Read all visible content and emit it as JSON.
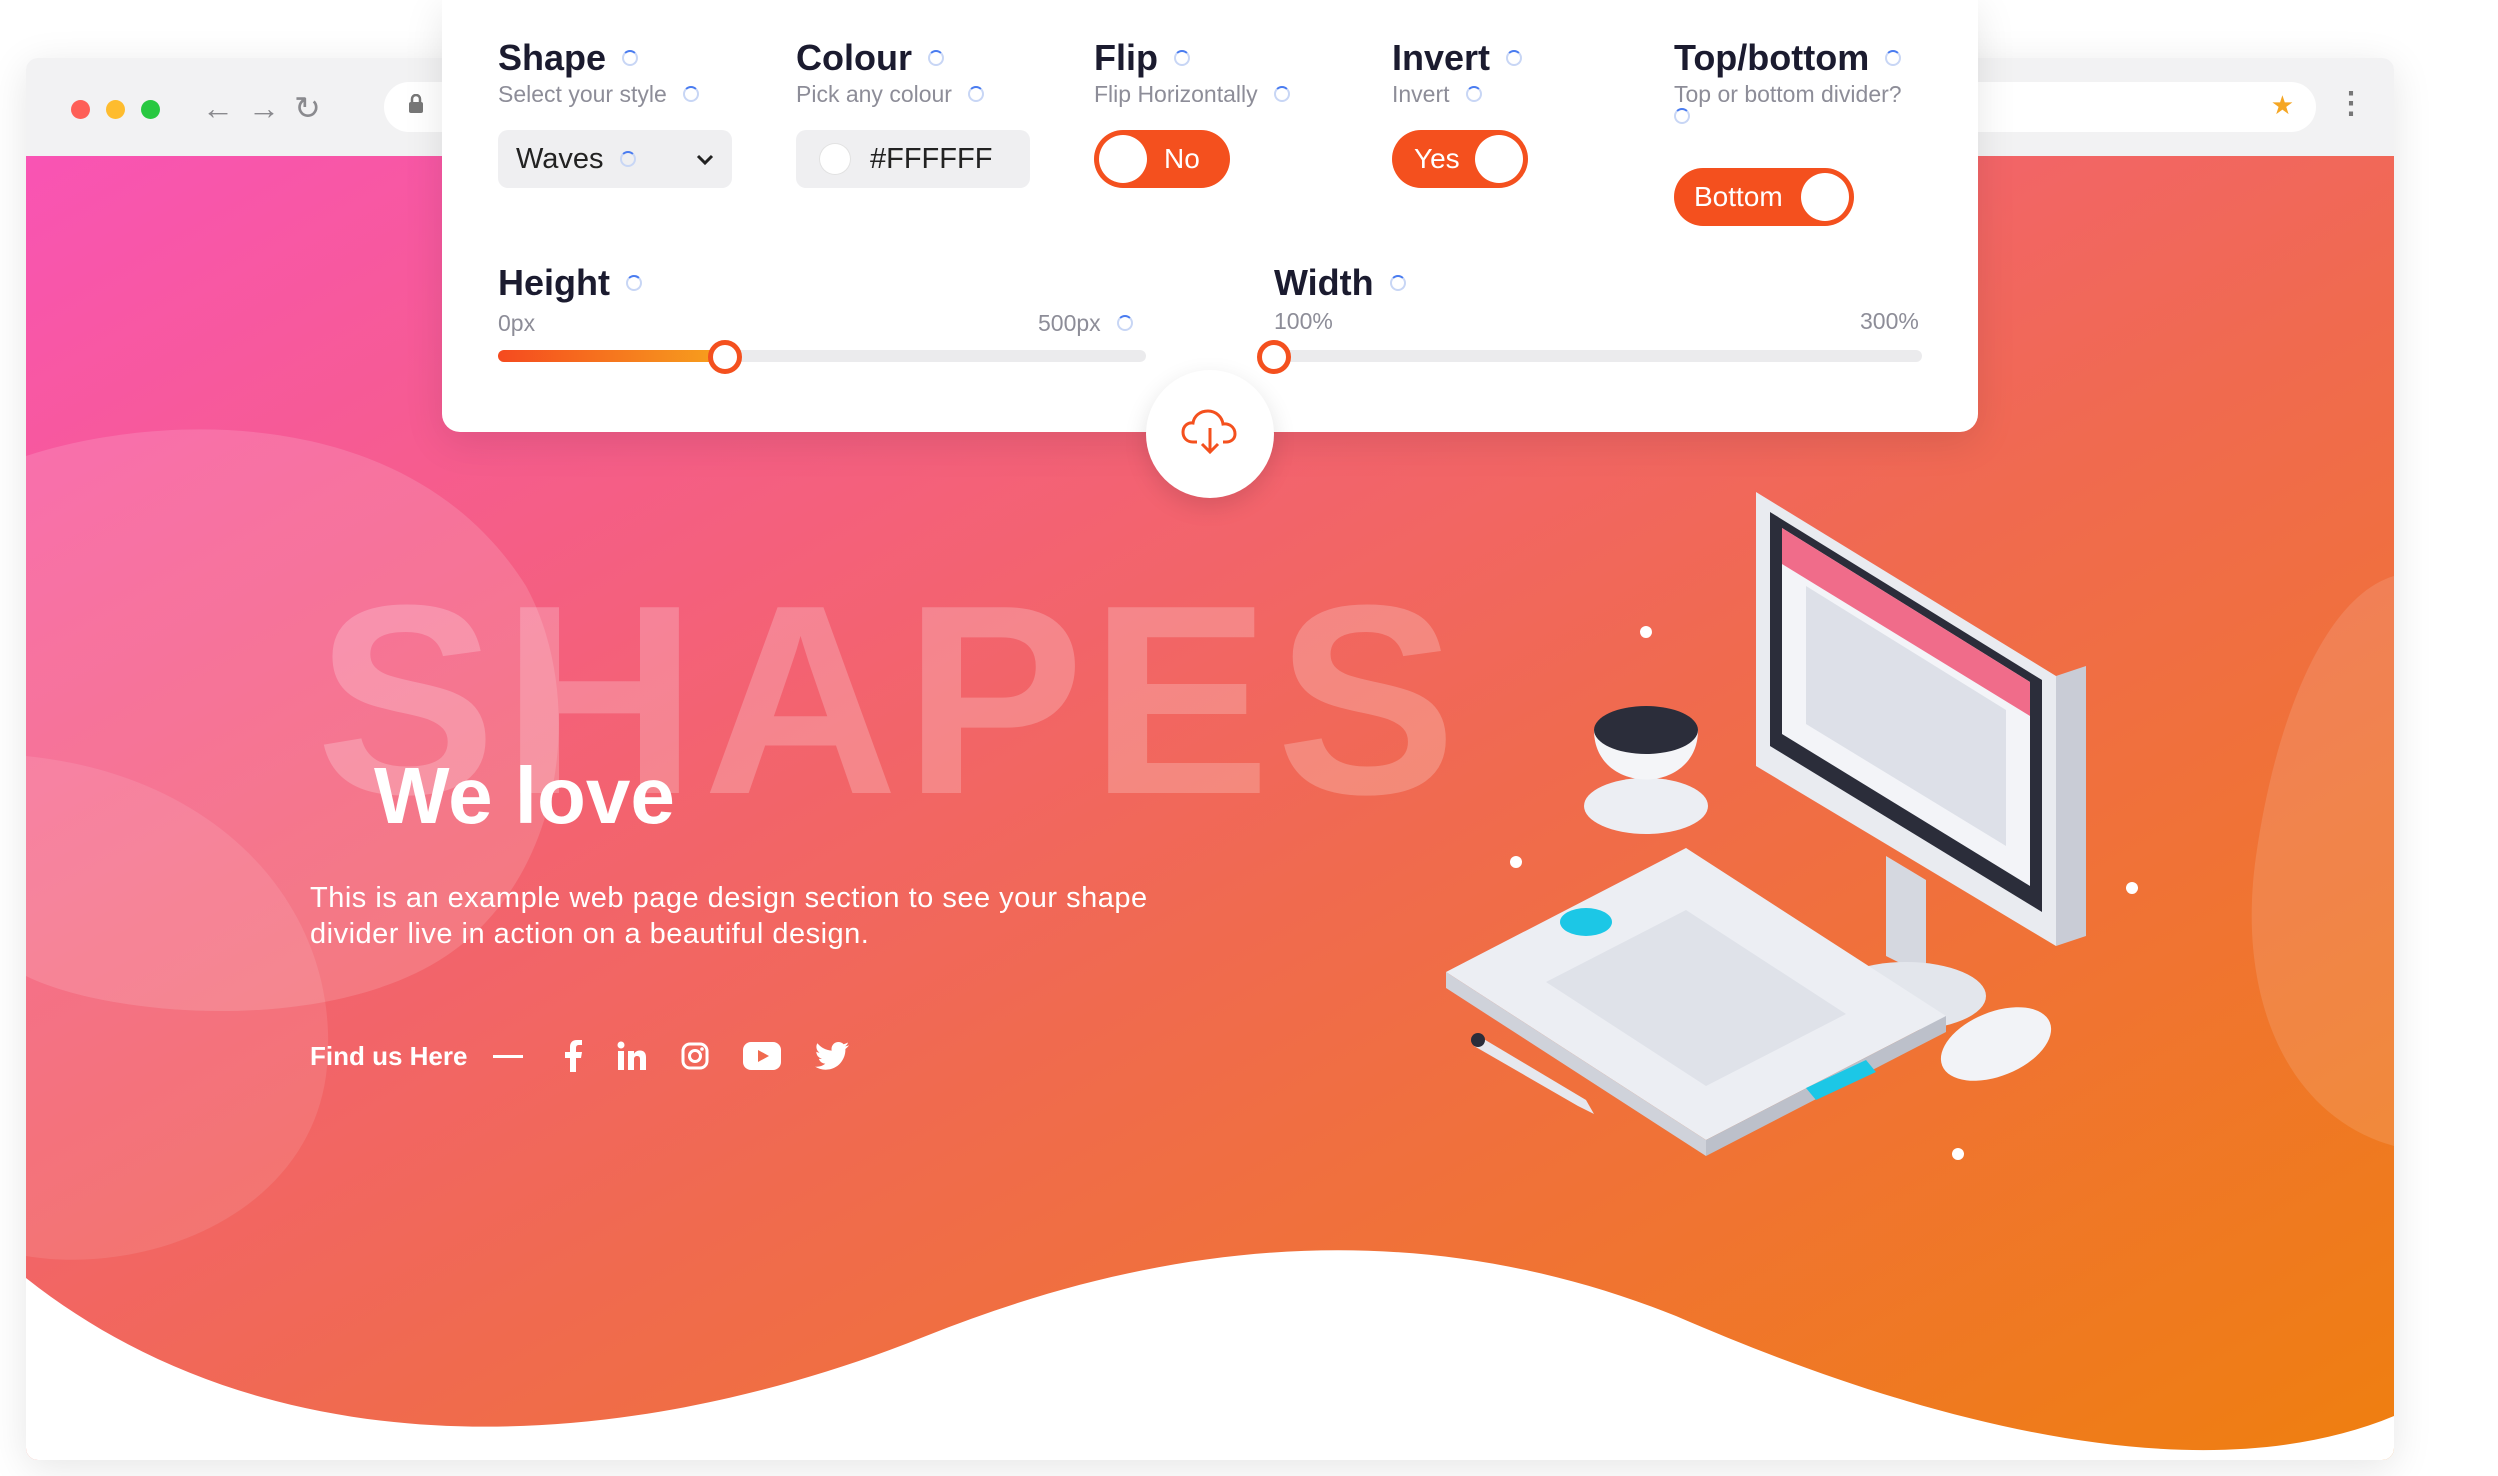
{
  "browser": {
    "nav_back": "←",
    "nav_forward": "→",
    "nav_reload": "↻",
    "lock": "🔒",
    "bookmark": "★",
    "menu": "⋮"
  },
  "settings": {
    "shape": {
      "label": "Shape",
      "subtitle": "Select your style",
      "value": "Waves"
    },
    "colour": {
      "label": "Colour",
      "subtitle": "Pick any colour",
      "value": "#FFFFFF"
    },
    "flip": {
      "label": "Flip",
      "subtitle": "Flip Horizontally",
      "value": "No"
    },
    "invert": {
      "label": "Invert",
      "subtitle": "Invert",
      "value": "Yes"
    },
    "position": {
      "label": "Top/bottom",
      "subtitle": "Top or bottom divider?",
      "value": "Bottom"
    },
    "height": {
      "label": "Height",
      "min": "0px",
      "max": "500px",
      "level": 0.35
    },
    "width": {
      "label": "Width",
      "min": "100%",
      "max": "300%",
      "level": 0.0
    }
  },
  "hero": {
    "watermark": "SHAPES",
    "headline": "We love",
    "description": "This is an example web page design section to see your shape divider live in action on a beautiful design.",
    "find_label": "Find us Here",
    "social_icons": [
      "facebook-icon",
      "linkedin-icon",
      "instagram-icon",
      "youtube-icon",
      "twitter-icon"
    ]
  },
  "colors": {
    "gradient_start": "#f954b4",
    "gradient_end": "#ef7f0f",
    "accent": "#f4501e",
    "panel_text": "#1b1b2f"
  }
}
